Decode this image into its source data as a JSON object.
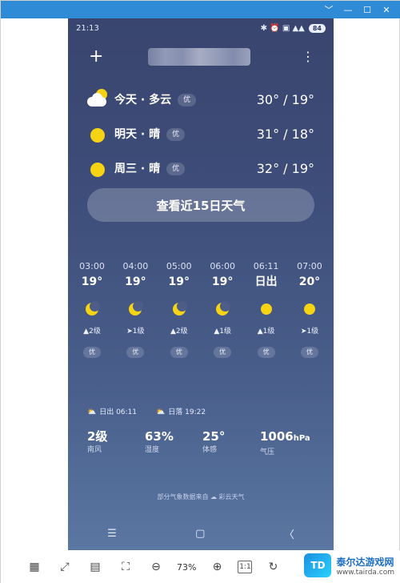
{
  "window": {
    "controls": [
      "﹀",
      "—",
      "☐",
      "✕"
    ]
  },
  "status": {
    "time": "21:13",
    "icons": "✱ ⏰ ▣ ▲▲",
    "battery": "84"
  },
  "top": {
    "plus": "+",
    "more": "⋮"
  },
  "forecast": [
    {
      "label": "今天 · 多云",
      "aqi": "优",
      "temps": "30° / 19°",
      "icon": "cloud-sun-icon"
    },
    {
      "label": "明天 · 晴",
      "aqi": "优",
      "temps": "31° / 18°",
      "icon": "sun-icon"
    },
    {
      "label": "周三 · 晴",
      "aqi": "优",
      "temps": "32° / 19°",
      "icon": "sun-icon"
    }
  ],
  "cta": "查看近15日天气",
  "hourly": [
    {
      "time": "03:00",
      "temp": "19°",
      "icon": "moon",
      "wind": "▲2级",
      "aqi": "优"
    },
    {
      "time": "04:00",
      "temp": "19°",
      "icon": "moon",
      "wind": "➤1级",
      "aqi": "优"
    },
    {
      "time": "05:00",
      "temp": "19°",
      "icon": "moon",
      "wind": "▲2级",
      "aqi": "优"
    },
    {
      "time": "06:00",
      "temp": "19°",
      "icon": "moon",
      "wind": "▲1级",
      "aqi": "优"
    },
    {
      "time": "06:11",
      "temp": "日出",
      "icon": "sun",
      "wind": "▲1级",
      "aqi": "优"
    },
    {
      "time": "07:00",
      "temp": "20°",
      "icon": "sun",
      "wind": "➤1级",
      "aqi": "优"
    }
  ],
  "sun": {
    "sunrise": "日出 06:11",
    "sunset": "日落 19:22"
  },
  "stats": [
    {
      "value": "2级",
      "unit": "",
      "label": "南风"
    },
    {
      "value": "63%",
      "unit": "",
      "label": "湿度"
    },
    {
      "value": "25°",
      "unit": "",
      "label": "体感"
    },
    {
      "value": "1006",
      "unit": "hPa",
      "label": "气压"
    }
  ],
  "source": "部分气象数据来自 ☁ 彩云天气",
  "nav": [
    "☰",
    "▢",
    "〈"
  ],
  "toolbar": {
    "zoom": "73%",
    "ratio": "1:1"
  },
  "watermark": {
    "name": "泰尔达游戏网",
    "url": "www.tairda.com"
  }
}
